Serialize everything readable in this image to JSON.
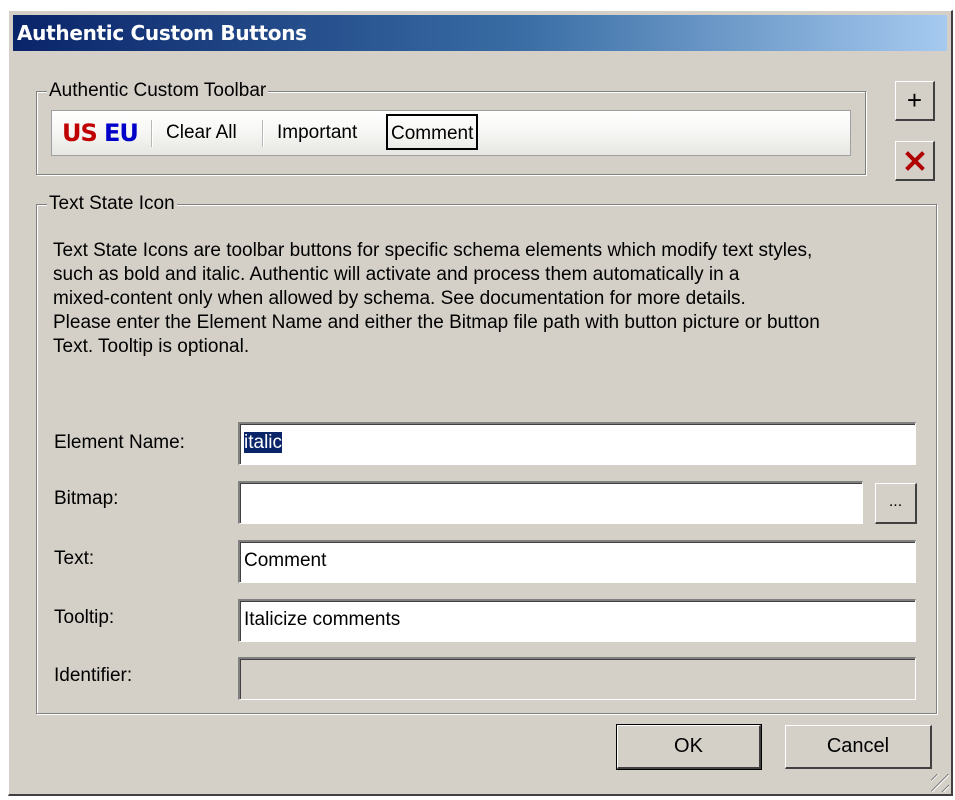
{
  "window": {
    "title": "Authentic Custom Buttons"
  },
  "toolbar_group": {
    "legend": "Authentic Custom Toolbar",
    "buttons": [
      "US",
      "EU",
      "Clear All",
      "Important",
      "Comment"
    ],
    "selected": "Comment",
    "add_label": "+",
    "remove_icon": "x-delete-icon"
  },
  "text_state_group": {
    "legend": "Text State Icon",
    "description": [
      "Text State Icons are toolbar buttons for specific schema elements which modify text styles,",
      "such as bold and italic. Authentic will activate and process them automatically in a",
      "mixed-content only when allowed by schema. See documentation for more details.",
      "Please enter the Element Name and either the Bitmap file path with button picture or button",
      "Text. Tooltip is optional."
    ],
    "fields": {
      "element_name": {
        "label": "Element Name:",
        "value": "italic"
      },
      "bitmap": {
        "label": "Bitmap:",
        "value": "",
        "browse_label": "..."
      },
      "text": {
        "label": "Text:",
        "value": "Comment"
      },
      "tooltip": {
        "label": "Tooltip:",
        "value": "Italicize comments"
      },
      "identifier": {
        "label": "Identifier:",
        "value": ""
      }
    }
  },
  "footer": {
    "ok_label": "OK",
    "cancel_label": "Cancel"
  },
  "colors": {
    "title_start": "#0a246a",
    "title_end": "#a6caf0",
    "face": "#d4d0c8",
    "us": "#c00000",
    "eu": "#0000c8",
    "remove": "#b00000"
  }
}
